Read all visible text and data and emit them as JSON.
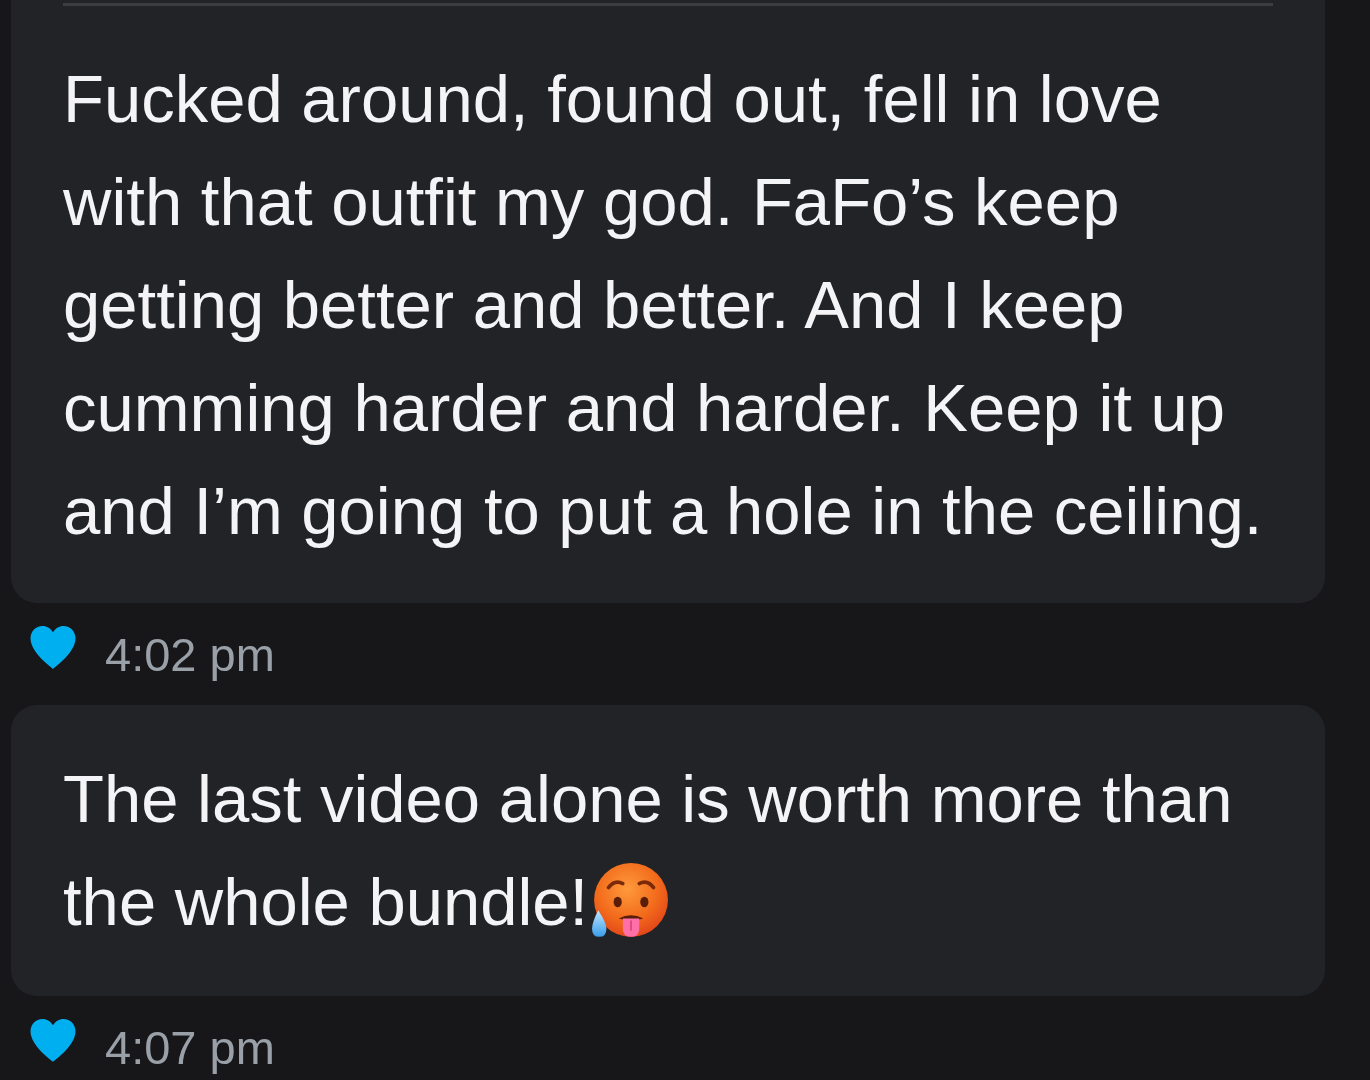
{
  "messages": [
    {
      "text": "Fucked around, found out, fell in love with that outfit my god. FaFo’s keep getting better and better. And I keep cumming harder and harder. Keep it up and I’m going to put a hole in the ceiling.",
      "divider_above": true,
      "liked": true,
      "time": "4:02 pm"
    },
    {
      "text": "The last video alone is worth more than the whole bundle!",
      "emoji": true,
      "liked": true,
      "time": "4:07 pm"
    }
  ]
}
